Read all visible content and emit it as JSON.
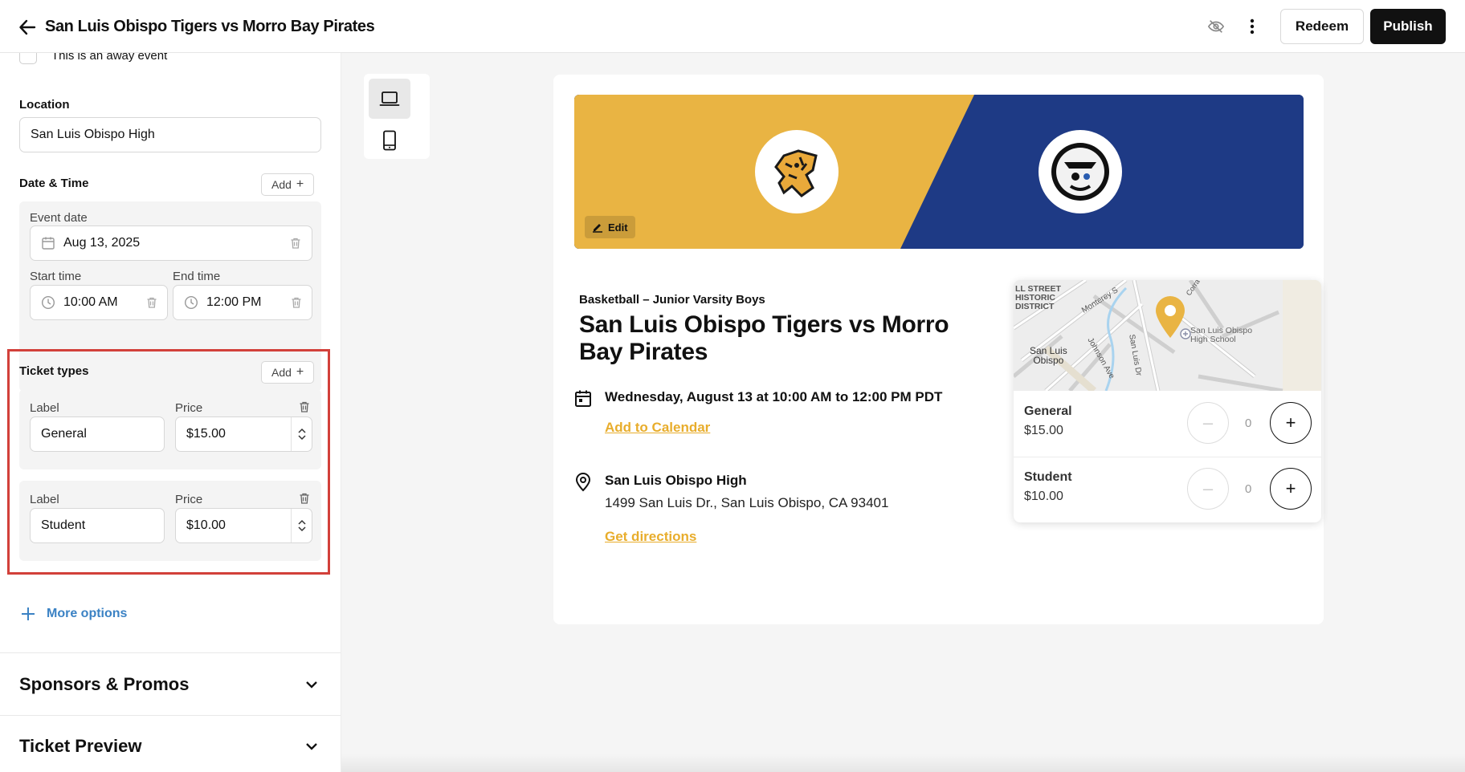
{
  "header": {
    "title": "San Luis Obispo Tigers vs Morro Bay Pirates",
    "redeem_label": "Redeem",
    "publish_label": "Publish"
  },
  "left_panel": {
    "away_event_label": "This is an away event",
    "location": {
      "label": "Location",
      "value": "San Luis Obispo High"
    },
    "date_time": {
      "label": "Date & Time",
      "add_label": "Add",
      "event_date_label": "Event date",
      "event_date_value": "Aug 13, 2025",
      "start_time_label": "Start time",
      "start_time_value": "10:00 AM",
      "end_time_label": "End time",
      "end_time_value": "12:00 PM"
    },
    "ticket_types": {
      "label": "Ticket types",
      "add_label": "Add",
      "items": [
        {
          "label_caption": "Label",
          "label_value": "General",
          "price_caption": "Price",
          "price_value": "$15.00"
        },
        {
          "label_caption": "Label",
          "label_value": "Student",
          "price_caption": "Price",
          "price_value": "$10.00"
        }
      ]
    },
    "more_options_label": "More options",
    "sections": [
      {
        "label": "Sponsors & Promos"
      },
      {
        "label": "Ticket Preview"
      }
    ]
  },
  "preview": {
    "edit_label": "Edit",
    "category": "Basketball – Junior Varsity Boys",
    "event_title": "San Luis Obispo Tigers vs Morro Bay Pirates",
    "datetime_text": "Wednesday, August 13 at 10:00 AM to 12:00 PM PDT",
    "add_to_calendar": "Add to Calendar",
    "venue_name": "San Luis Obispo High",
    "venue_address": "1499 San Luis Dr., San Luis Obispo, CA 93401",
    "get_directions": "Get directions",
    "map_labels": {
      "historic": "LL STREET\nHISTORIC\nDISTRICT",
      "monterey": "Monterey S",
      "school": "San Luis Obispo\nHigh School",
      "city": "San Luis\nObispo",
      "johnson": "Johnson Ave",
      "sanluisdr": "San Luis Dr",
      "corr": "Corra"
    },
    "tickets": [
      {
        "name": "General",
        "price": "$15.00",
        "qty": "0"
      },
      {
        "name": "Student",
        "price": "$10.00",
        "qty": "0"
      }
    ],
    "qty_minus": "–",
    "qty_plus": "+"
  },
  "colors": {
    "banner_left": "#e9b443",
    "banner_right": "#1e3a85",
    "accent_link": "#e8ad2c",
    "highlight_outline": "#d2403a",
    "more_options_blue": "#3b82c4"
  }
}
